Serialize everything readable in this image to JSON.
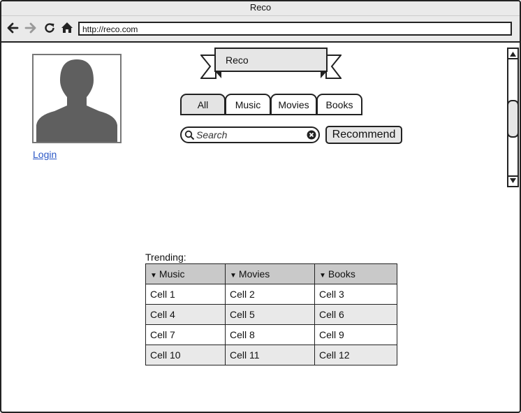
{
  "window": {
    "title": "Reco"
  },
  "toolbar": {
    "url": "http://reco.com",
    "icons": [
      "back-arrow-icon",
      "forward-arrow-icon",
      "reload-icon",
      "home-icon"
    ]
  },
  "profile": {
    "avatar": "user-silhouette-icon",
    "login_label": "Login"
  },
  "header": {
    "banner_title": "Reco"
  },
  "tabs": [
    {
      "label": "All",
      "active": true
    },
    {
      "label": "Music",
      "active": false
    },
    {
      "label": "Movies",
      "active": false
    },
    {
      "label": "Books",
      "active": false
    }
  ],
  "search": {
    "placeholder": "Search",
    "value": "",
    "button_label": "Recommend"
  },
  "trending": {
    "label": "Trending:",
    "columns": [
      "Music",
      "Movies",
      "Books"
    ],
    "rows": [
      [
        "Cell 1",
        "Cell 2",
        "Cell 3"
      ],
      [
        "Cell 4",
        "Cell 5",
        "Cell 6"
      ],
      [
        "Cell 7",
        "Cell 8",
        "Cell 9"
      ],
      [
        "Cell 10",
        "Cell 11",
        "Cell 12"
      ]
    ]
  },
  "colors": {
    "link": "#2a57c6",
    "header_bg": "#c9c9c9",
    "alt_row_bg": "#e9e9e9",
    "chrome_bg": "#eaeaea"
  }
}
